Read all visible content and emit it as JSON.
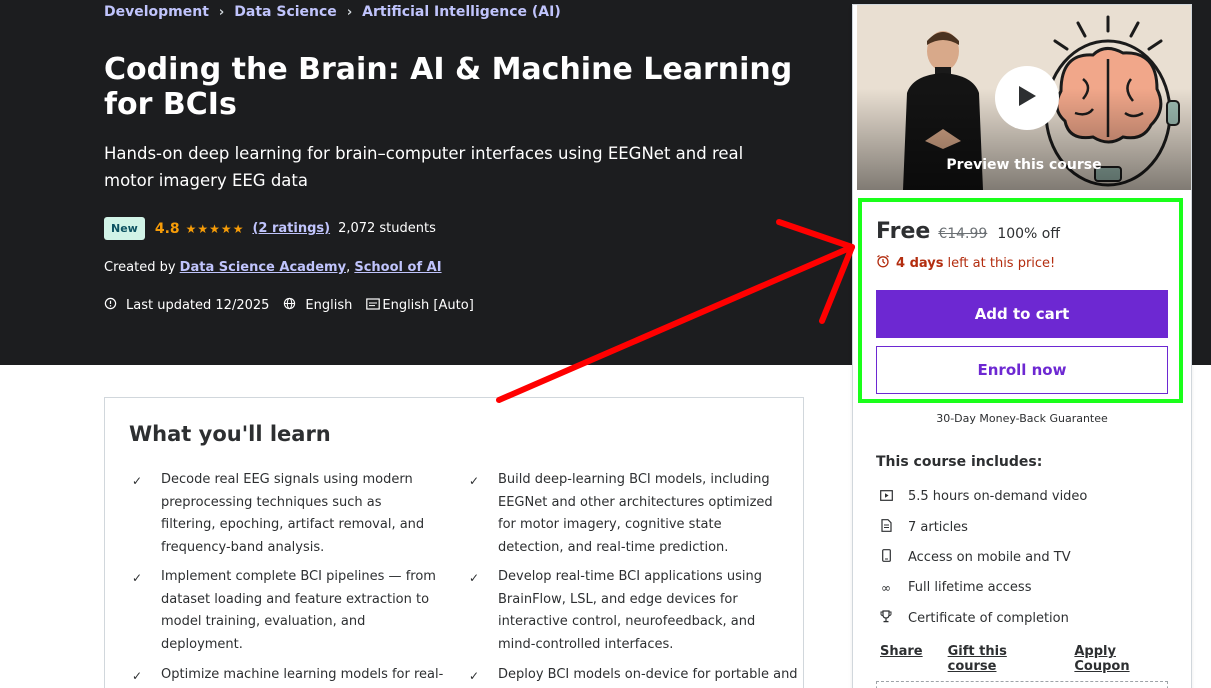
{
  "breadcrumb": [
    "Development",
    "Data Science",
    "Artificial Intelligence (AI)"
  ],
  "course": {
    "title": "Coding the Brain: AI & Machine Learning for BCIs",
    "subtitle": "Hands-on deep learning for brain–computer interfaces using EEGNet and real motor imagery EEG data",
    "badge": "New",
    "rating": "4.8",
    "stars": "★★★★★",
    "ratings_count": "(2 ratings)",
    "students": "2,072 students",
    "created_by_label": "Created by",
    "authors": [
      "Data Science Academy",
      "School of AI"
    ],
    "author_sep": ",",
    "last_updated": "Last updated 12/2025",
    "language": "English",
    "captions": "English [Auto]"
  },
  "learn": {
    "title": "What you'll learn",
    "items": [
      "Decode real EEG signals using modern preprocessing techniques such as filtering, epoching, artifact removal, and frequency-band analysis.",
      "Build deep-learning BCI models, including EEGNet and other architectures optimized for motor imagery, cognitive state detection, and real-time prediction.",
      "Implement complete BCI pipelines — from dataset loading and feature extraction to model training, evaluation, and deployment.",
      "Develop real-time BCI applications using BrainFlow, LSL, and edge devices for interactive control, neurofeedback, and mind-controlled interfaces.",
      "Optimize machine learning models for real-",
      "Deploy BCI models on-device for portable and"
    ]
  },
  "sidebar": {
    "preview_label": "Preview this course",
    "price": "Free",
    "original_price": "€14.99",
    "discount": "100% off",
    "timer_days": "4 days",
    "timer_rest": "left at this price!",
    "add_to_cart": "Add to cart",
    "enroll_now": "Enroll now",
    "guarantee": "30-Day Money-Back Guarantee",
    "includes_title": "This course includes:",
    "includes": [
      {
        "icon": "video-icon",
        "text": "5.5 hours on-demand video"
      },
      {
        "icon": "article-icon",
        "text": "7 articles"
      },
      {
        "icon": "mobile-icon",
        "text": "Access on mobile and TV"
      },
      {
        "icon": "infinity-icon",
        "text": "Full lifetime access"
      },
      {
        "icon": "trophy-icon",
        "text": "Certificate of completion"
      }
    ],
    "actions": [
      "Share",
      "Gift this course",
      "Apply Coupon"
    ]
  },
  "colors": {
    "hero_bg": "#1c1d1f",
    "link_purple": "#c0c4fc",
    "brand_purple": "#6d28d2",
    "star_orange": "#f69c08",
    "timer_red": "#b32d0f",
    "highlight_green": "#1aff1a",
    "arrow_red": "#ff0000"
  }
}
